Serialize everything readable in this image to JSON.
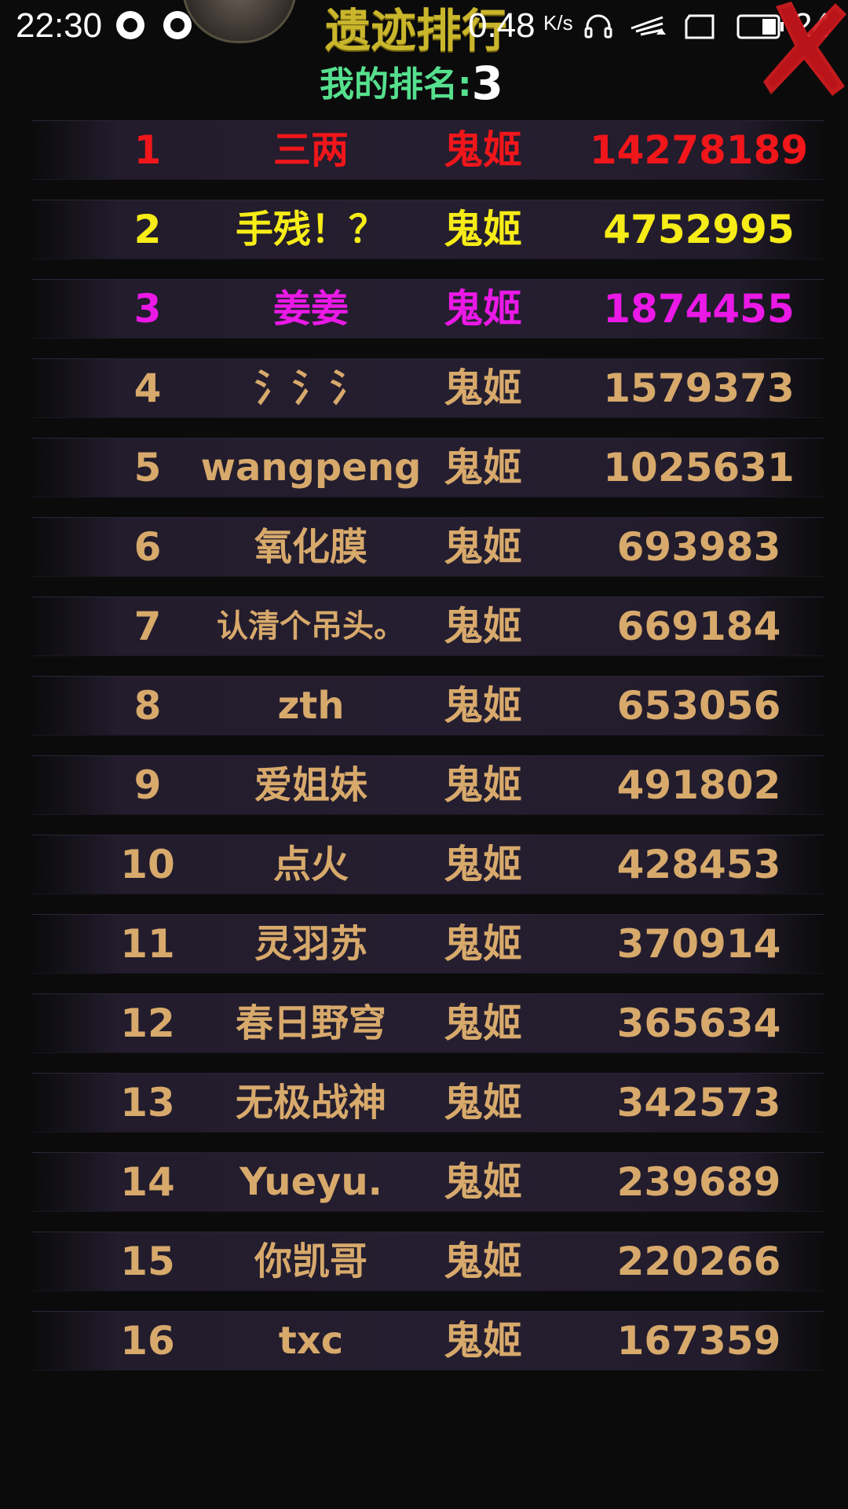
{
  "status_bar": {
    "time": "22:30",
    "net_speed": "0.48",
    "net_speed_unit": "K/s",
    "battery": "24"
  },
  "header": {
    "title": "遗迹排行",
    "my_rank_label": "我的排名:",
    "my_rank_value": "3"
  },
  "colors": {
    "rank_1": "#f0161a",
    "rank_2": "#f6ec17",
    "rank_3": "#ea19e6",
    "rank_default": "#d7a96b",
    "my_rank_label": "#56e08e",
    "title": "#c9b62c"
  },
  "rankings": [
    {
      "rank": "1",
      "name": "三两",
      "class": "鬼姬",
      "score": "14278189"
    },
    {
      "rank": "2",
      "name": "手残！？",
      "class": "鬼姬",
      "score": "4752995"
    },
    {
      "rank": "3",
      "name": "姜姜",
      "class": "鬼姬",
      "score": "1874455"
    },
    {
      "rank": "4",
      "name": "氵氵氵",
      "class": "鬼姬",
      "score": "1579373"
    },
    {
      "rank": "5",
      "name": "wangpeng",
      "class": "鬼姬",
      "score": "1025631"
    },
    {
      "rank": "6",
      "name": "氧化膜",
      "class": "鬼姬",
      "score": "693983"
    },
    {
      "rank": "7",
      "name": "认清个吊头。",
      "class": "鬼姬",
      "score": "669184"
    },
    {
      "rank": "8",
      "name": "zth",
      "class": "鬼姬",
      "score": "653056"
    },
    {
      "rank": "9",
      "name": "爱姐妹",
      "class": "鬼姬",
      "score": "491802"
    },
    {
      "rank": "10",
      "name": "点火",
      "class": "鬼姬",
      "score": "428453"
    },
    {
      "rank": "11",
      "name": "灵羽苏",
      "class": "鬼姬",
      "score": "370914"
    },
    {
      "rank": "12",
      "name": "春日野穹",
      "class": "鬼姬",
      "score": "365634"
    },
    {
      "rank": "13",
      "name": "无极战神",
      "class": "鬼姬",
      "score": "342573"
    },
    {
      "rank": "14",
      "name": "Yueyu.",
      "class": "鬼姬",
      "score": "239689"
    },
    {
      "rank": "15",
      "name": "你凯哥",
      "class": "鬼姬",
      "score": "220266"
    },
    {
      "rank": "16",
      "name": "txc",
      "class": "鬼姬",
      "score": "167359"
    }
  ]
}
